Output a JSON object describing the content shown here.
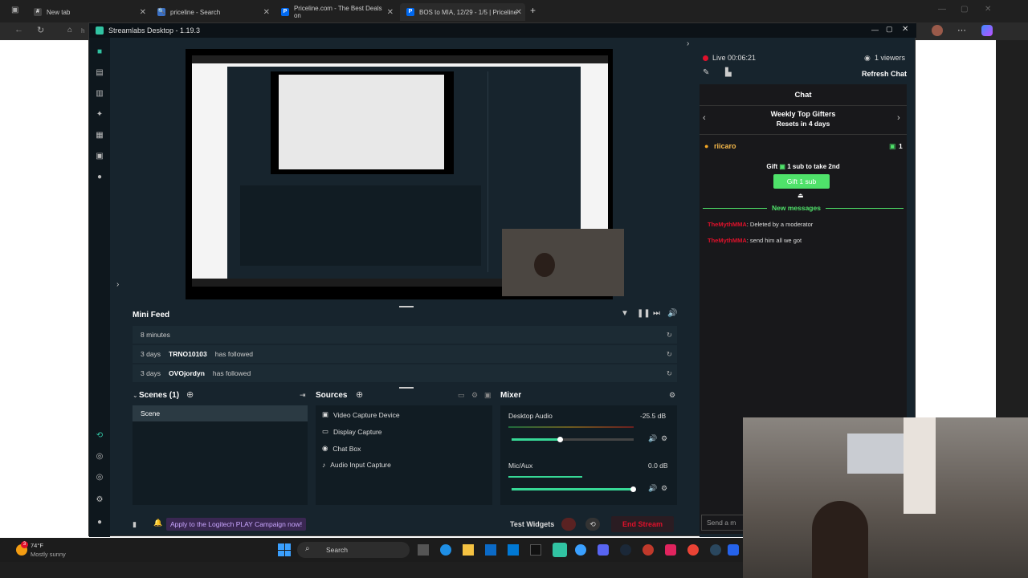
{
  "browser": {
    "tabs": [
      {
        "title": "New tab",
        "fav": "#"
      },
      {
        "title": "priceline - Search",
        "fav": "🔍"
      },
      {
        "title": "Priceline.com - The Best Deals on",
        "fav": "P"
      },
      {
        "title": "BOS to MIA, 12/29 - 1/5 | Priceline",
        "fav": "P"
      }
    ],
    "new_tab": "+",
    "address_partial": "h"
  },
  "app": {
    "title": "Streamlabs Desktop - 1.19.3"
  },
  "mini_feed": {
    "title": "Mini Feed",
    "rows": [
      {
        "time": "8 minutes",
        "user": "",
        "action": ""
      },
      {
        "time": "3 days",
        "user": "TRNO10103",
        "action": "has followed"
      },
      {
        "time": "3 days",
        "user": "OVOjordyn",
        "action": "has followed"
      }
    ]
  },
  "scenes": {
    "title": "Scenes (1)",
    "items": [
      "Scene"
    ]
  },
  "sources": {
    "title": "Sources",
    "items": [
      "Video Capture Device",
      "Display Capture",
      "Chat Box",
      "Audio Input Capture"
    ]
  },
  "mixer": {
    "title": "Mixer",
    "channels": [
      {
        "name": "Desktop Audio",
        "db": "-25.5 dB",
        "level": 0.4
      },
      {
        "name": "Mic/Aux",
        "db": "0.0 dB",
        "level": 1.0
      }
    ]
  },
  "footer": {
    "promo": "Apply to the Logitech PLAY Campaign now!",
    "test_widgets": "Test Widgets",
    "end_stream": "End Stream"
  },
  "chat": {
    "live": "Live 00:06:21",
    "viewers": "1 viewers",
    "refresh": "Refresh Chat",
    "title": "Chat",
    "gifters_title": "Weekly Top Gifters",
    "gifters_sub": "Resets in 4 days",
    "top_gifter": "riicaro",
    "top_gifter_count": "1",
    "gift_prompt_a": "Gift",
    "gift_prompt_b": "1 sub",
    "gift_prompt_c": "to take 2nd",
    "gift_button": "Gift 1 sub",
    "new_messages": "New messages",
    "messages": [
      {
        "user": "TheMythMMA",
        "text": ": Deleted by a moderator"
      },
      {
        "user": "TheMythMMA",
        "text": ": send him all we got"
      }
    ],
    "send_placeholder": "Send a m"
  },
  "taskbar": {
    "weather_temp": "74°F",
    "weather_desc": "Mostly sunny",
    "search": "Search"
  },
  "colors": {
    "accent": "#31c3a2",
    "live_red": "#e0112b",
    "end_stream": "#e0112b"
  }
}
